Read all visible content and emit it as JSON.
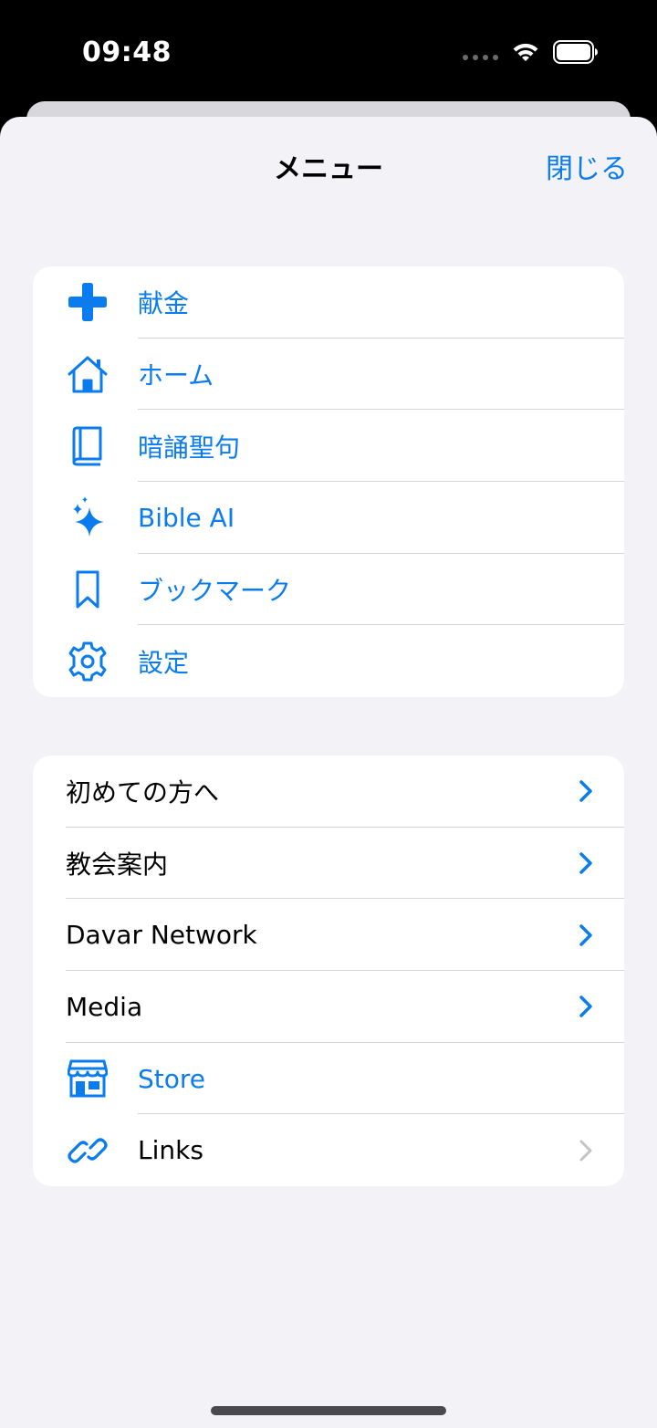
{
  "status": {
    "time": "09:48"
  },
  "nav": {
    "title": "メニュー",
    "close_label": "閉じる"
  },
  "group1": [
    {
      "label": "献金",
      "icon": "plus-icon"
    },
    {
      "label": "ホーム",
      "icon": "house-icon"
    },
    {
      "label": "暗誦聖句",
      "icon": "book-icon"
    },
    {
      "label": "Bible AI",
      "icon": "sparkles-icon"
    },
    {
      "label": "ブックマーク",
      "icon": "bookmark-icon"
    },
    {
      "label": "設定",
      "icon": "gear-icon"
    }
  ],
  "group2": [
    {
      "label": "初めての方へ",
      "chevron": "blue"
    },
    {
      "label": "教会案内",
      "chevron": "blue"
    },
    {
      "label": "Davar Network",
      "chevron": "blue"
    },
    {
      "label": "Media",
      "chevron": "blue"
    },
    {
      "label": "Store",
      "icon": "storefront-icon"
    },
    {
      "label": "Links",
      "icon": "link-icon",
      "chevron": "gray"
    }
  ],
  "colors": {
    "accent": "#0a7cf0",
    "background": "#f2f2f7",
    "chevron_gray": "#c4c4c7"
  }
}
